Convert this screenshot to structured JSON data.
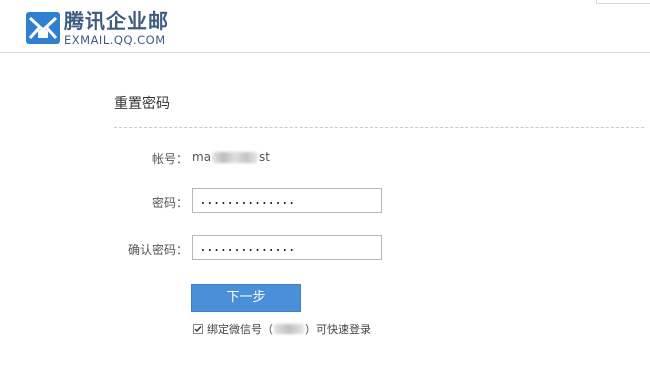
{
  "header": {
    "brand_cn": "腾讯企业邮",
    "brand_en": "EXMAIL.QQ.COM",
    "logo_icon": "envelope-logo-icon"
  },
  "panel": {
    "title": "重置密码",
    "account_label": "帐号：",
    "account_value_prefix": "ma",
    "account_value_suffix": "st",
    "password_label": "密码：",
    "password_value": "..............",
    "confirm_label": "确认密码：",
    "confirm_value": "..............",
    "next_button": "下一步",
    "bind_text_prefix": "绑定微信号（",
    "bind_text_partial": "",
    "bind_text_suffix": "）可快速登录",
    "bind_checked": true
  },
  "colors": {
    "brand": "#3f5b80",
    "button": "#4a90d9"
  }
}
